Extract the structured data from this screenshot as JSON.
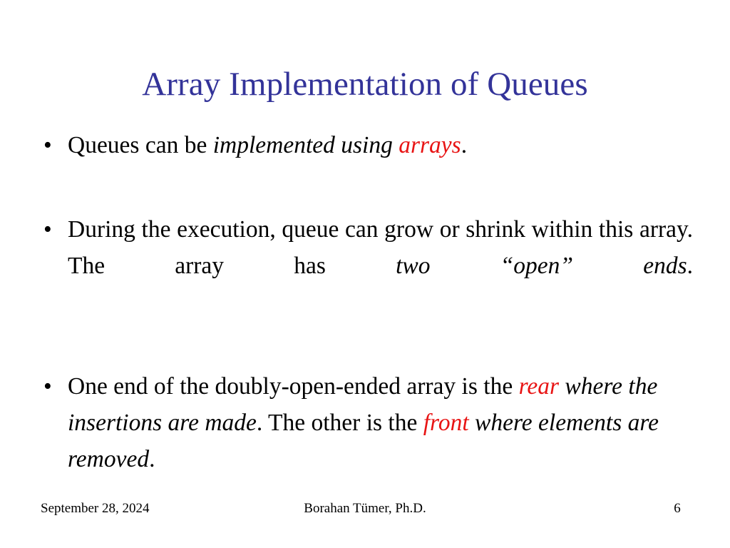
{
  "slide": {
    "title": "Array Implementation of Queues",
    "title_color": "#333399",
    "background_color": "#ffffff",
    "body_text_color": "#000000",
    "accent_color": "#e81414",
    "bullet_glyph": "•"
  },
  "bullets": [
    {
      "id": "bullet-arrays",
      "segments": [
        {
          "text": "Queues can be ",
          "style": "normal"
        },
        {
          "text": "implemented using ",
          "style": "italic"
        },
        {
          "text": "arrays",
          "style": "italic-red"
        },
        {
          "text": ".",
          "style": "normal"
        }
      ],
      "plain": "Queues can be implemented using arrays."
    },
    {
      "id": "bullet-grow-shrink",
      "segments": [
        {
          "text": "During the execution, queue can grow or shrink within this array.  The array has ",
          "style": "normal"
        },
        {
          "text": "two “open” ends",
          "style": "italic"
        },
        {
          "text": ".",
          "style": "normal"
        }
      ],
      "plain": "During the execution, queue can grow or shrink within this array.  The array has two “open” ends."
    },
    {
      "id": "bullet-rear-front",
      "segments": [
        {
          "text": "One end of the doubly-open-ended array is the ",
          "style": "normal"
        },
        {
          "text": "rear",
          "style": "italic-red"
        },
        {
          "text": " where the insertions are made",
          "style": "italic"
        },
        {
          "text": ".  The other is the ",
          "style": "normal"
        },
        {
          "text": "front",
          "style": "italic-red"
        },
        {
          "text": " where elements are removed",
          "style": "italic"
        },
        {
          "text": ".",
          "style": "normal"
        }
      ],
      "plain": "One end of the doubly-open-ended array is the rear where the insertions are made.  The other is the front where elements are removed."
    }
  ],
  "bullet_1_parts": {
    "lead": "Queues can be ",
    "italic": "implemented using ",
    "red": "arrays",
    "tail": "."
  },
  "bullet_2_parts": {
    "lead": "During the execution, queue can grow or shrink within this array.  The array has ",
    "italic": "two “open” ends",
    "tail": "."
  },
  "bullet_3_parts": {
    "lead": "One end of the doubly-open-ended array is the ",
    "red1": "rear",
    "italic1": " where the insertions are made",
    "mid": ".  The other is the ",
    "red2": "front",
    "italic2": " where elements are removed",
    "tail": "."
  },
  "footer": {
    "date": "September 28, 2024",
    "author": "Borahan Tümer, Ph.D.",
    "page_number": "6"
  }
}
